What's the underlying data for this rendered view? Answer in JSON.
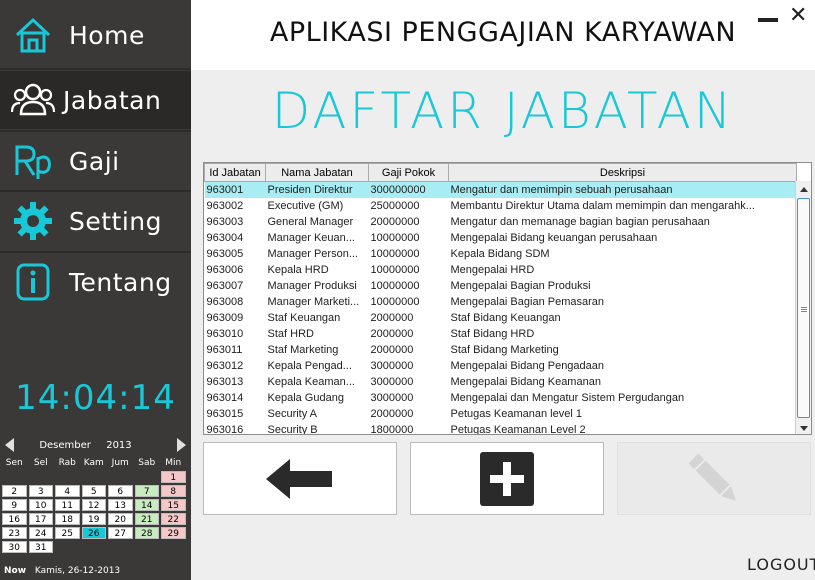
{
  "sidebar": {
    "nav": [
      {
        "label": "Home",
        "icon": "home-icon"
      },
      {
        "label": "Jabatan",
        "icon": "users-icon"
      },
      {
        "label": "Gaji",
        "icon": "rupiah-icon"
      },
      {
        "label": "Setting",
        "icon": "gear-icon"
      },
      {
        "label": "Tentang",
        "icon": "info-icon"
      }
    ],
    "clock": "14:04:14"
  },
  "calendar": {
    "month": "Desember",
    "year": "2013",
    "weekdays": [
      "Sen",
      "Sel",
      "Rab",
      "Kam",
      "Jum",
      "Sab",
      "Min"
    ],
    "weeks": [
      [
        "",
        "",
        "",
        "",
        "",
        "",
        "1"
      ],
      [
        "2",
        "3",
        "4",
        "5",
        "6",
        "7",
        "8"
      ],
      [
        "9",
        "10",
        "11",
        "12",
        "13",
        "14",
        "15"
      ],
      [
        "16",
        "17",
        "18",
        "19",
        "20",
        "21",
        "22"
      ],
      [
        "23",
        "24",
        "25",
        "26",
        "27",
        "28",
        "29"
      ],
      [
        "30",
        "31",
        "",
        "",
        "",
        "",
        ""
      ]
    ],
    "today": "26",
    "now_label": "Now",
    "now_value": "Kamis, 26-12-2013"
  },
  "header": {
    "title": "APLIKASI PENGGAJIAN KARYAWAN"
  },
  "page": {
    "heading": "DAFTAR JABATAN"
  },
  "table": {
    "columns": [
      "Id Jabatan",
      "Nama Jabatan",
      "Gaji Pokok",
      "Deskripsi"
    ],
    "rows": [
      [
        "963001",
        "Presiden Direktur",
        "300000000",
        "Mengatur dan memimpin sebuah perusahaan"
      ],
      [
        "963002",
        "Executive (GM)",
        "25000000",
        "Membantu Direktur Utama dalam memimpin dan mengarahk..."
      ],
      [
        "963003",
        "General Manager",
        "20000000",
        "Mengatur dan memanage bagian bagian perusahaan"
      ],
      [
        "963004",
        "Manager Keuan...",
        "10000000",
        "Mengepalai Bidang keuangan perusahaan"
      ],
      [
        "963005",
        "Manager Person...",
        "10000000",
        "Kepala Bidang SDM"
      ],
      [
        "963006",
        "Kepala HRD",
        "10000000",
        "Mengepalai HRD"
      ],
      [
        "963007",
        "Manager Produksi",
        "10000000",
        "Mengepalai Bagian Produksi"
      ],
      [
        "963008",
        "Manager Marketi...",
        "10000000",
        "Mengepalai Bagian Pemasaran"
      ],
      [
        "963009",
        "Staf Keuangan",
        "2000000",
        "Staf Bidang Keuangan"
      ],
      [
        "963010",
        "Staf HRD",
        "2000000",
        "Staf Bidang HRD"
      ],
      [
        "963011",
        "Staf Marketing",
        "2000000",
        "Staf Bidang Marketing"
      ],
      [
        "963012",
        "Kepala Pengad...",
        "3000000",
        "Mengepalai Bidang Pengadaan"
      ],
      [
        "963013",
        "Kepala Keaman...",
        "3000000",
        "Mengepalai Bidang Keamanan"
      ],
      [
        "963014",
        "Kepala Gudang",
        "3000000",
        "Mengepalai dan Mengatur Sistem Pergudangan"
      ],
      [
        "963015",
        "Security A",
        "2000000",
        "Petugas Keamanan level 1"
      ],
      [
        "963016",
        "Security B",
        "1800000",
        "Petugas Keamanan Level 2"
      ]
    ]
  },
  "footer": {
    "logout": "LOGOUT"
  },
  "colors": {
    "accent": "#19c8d8",
    "sidebar": "#3a3938"
  }
}
